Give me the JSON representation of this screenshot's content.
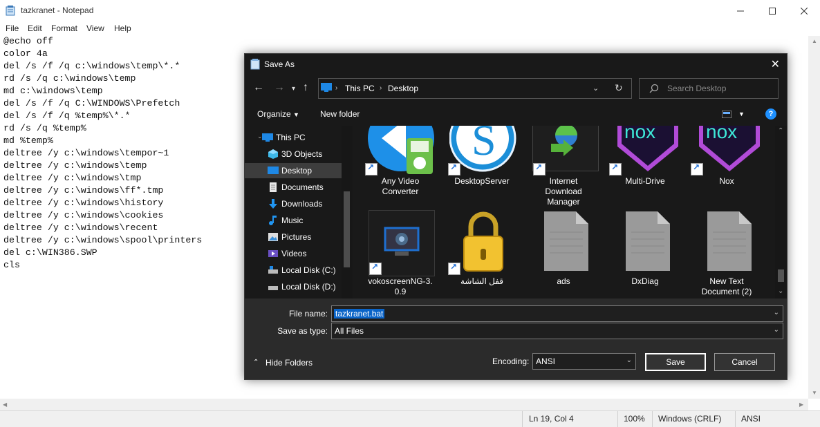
{
  "notepad": {
    "title": "tazkranet - Notepad",
    "menu": [
      "File",
      "Edit",
      "Format",
      "View",
      "Help"
    ],
    "lines": [
      "@echo off",
      "color 4a",
      "del /s /f /q c:\\windows\\temp\\*.*",
      "rd /s /q c:\\windows\\temp",
      "md c:\\windows\\temp",
      "del /s /f /q C:\\WINDOWS\\Prefetch",
      "del /s /f /q %temp%\\*.*",
      "rd /s /q %temp%",
      "md %temp%",
      "deltree /y c:\\windows\\tempor~1",
      "deltree /y c:\\windows\\temp",
      "deltree /y c:\\windows\\tmp",
      "deltree /y c:\\windows\\ff*.tmp",
      "deltree /y c:\\windows\\history",
      "deltree /y c:\\windows\\cookies",
      "deltree /y c:\\windows\\recent",
      "deltree /y c:\\windows\\spool\\printers",
      "del c:\\WIN386.SWP",
      "cls"
    ],
    "status": {
      "position": "Ln 19, Col 4",
      "zoom": "100%",
      "line_ending": "Windows (CRLF)",
      "encoding": "ANSI"
    }
  },
  "dialog": {
    "title": "Save As",
    "breadcrumb": [
      "This PC",
      "Desktop"
    ],
    "search_placeholder": "Search Desktop",
    "toolbar": {
      "organize": "Organize",
      "new_folder": "New folder"
    },
    "tree": [
      {
        "label": "This PC",
        "icon": "pc-icon"
      },
      {
        "label": "3D Objects",
        "icon": "cube-icon"
      },
      {
        "label": "Desktop",
        "icon": "desktop-icon",
        "selected": true
      },
      {
        "label": "Documents",
        "icon": "document-icon"
      },
      {
        "label": "Downloads",
        "icon": "download-icon"
      },
      {
        "label": "Music",
        "icon": "music-icon"
      },
      {
        "label": "Pictures",
        "icon": "picture-icon"
      },
      {
        "label": "Videos",
        "icon": "video-icon"
      },
      {
        "label": "Local Disk (C:)",
        "icon": "disk-icon"
      },
      {
        "label": "Local Disk (D:)",
        "icon": "disk-icon"
      }
    ],
    "files": [
      {
        "name": "Any Video Converter",
        "line1": "Any Video",
        "line2": "Converter",
        "icon": "video-converter-icon"
      },
      {
        "name": "DesktopServer",
        "line1": "DesktopServer",
        "line2": "",
        "icon": "desktopserver-icon"
      },
      {
        "name": "Internet Download Manager",
        "line1": "Internet",
        "line2": "Download",
        "line3": "Manager",
        "icon": "idm-icon"
      },
      {
        "name": "Multi-Drive",
        "line1": "Multi-Drive",
        "line2": "",
        "icon": "nox-icon"
      },
      {
        "name": "Nox",
        "line1": "Nox",
        "line2": "",
        "icon": "nox-icon"
      },
      {
        "name": "vokoscreenNG-3.0.9",
        "line1": "vokoscreenNG-3.",
        "line2": "0.9",
        "icon": "vokoscreen-icon"
      },
      {
        "name": "قفل الشاشة",
        "line1": "قفل الشاشة",
        "line2": "",
        "icon": "lock-icon"
      },
      {
        "name": "ads",
        "line1": "ads",
        "line2": "",
        "icon": "text-file-icon"
      },
      {
        "name": "DxDiag",
        "line1": "DxDiag",
        "line2": "",
        "icon": "text-file-icon"
      },
      {
        "name": "New Text Document (2)",
        "line1": "New Text",
        "line2": "Document (2)",
        "icon": "text-file-icon"
      }
    ],
    "file_name_label": "File name:",
    "file_name_value": "tazkranet.bat",
    "save_type_label": "Save as type:",
    "save_type_value": "All Files",
    "hide_folders": "Hide Folders",
    "encoding_label": "Encoding:",
    "encoding_value": "ANSI",
    "save": "Save",
    "cancel": "Cancel"
  }
}
